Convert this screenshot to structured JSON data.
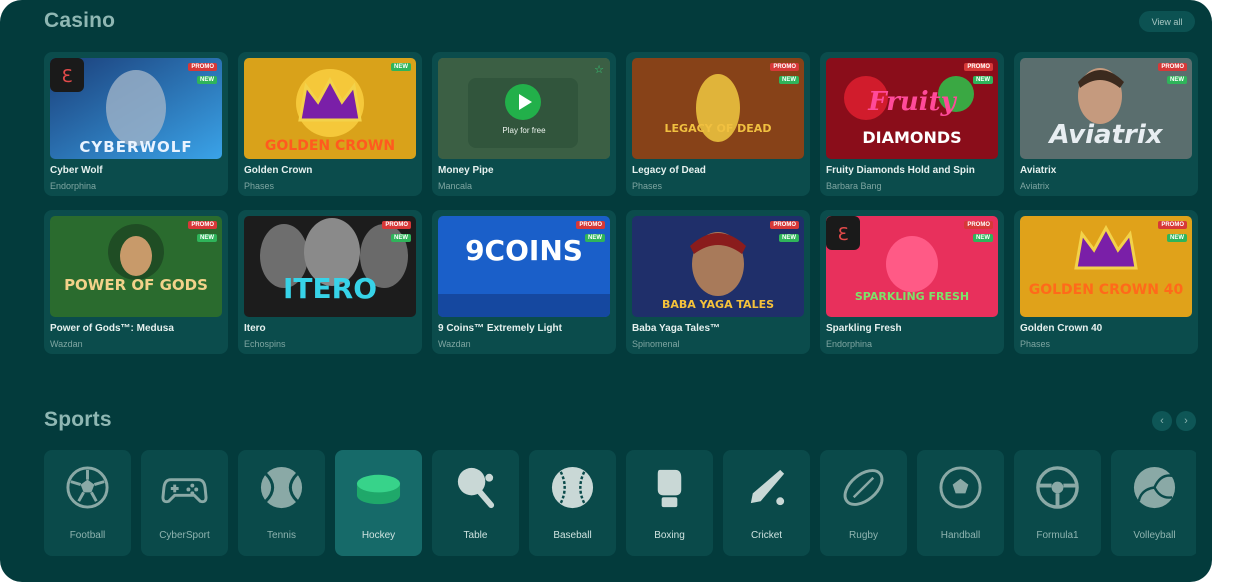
{
  "casino": {
    "title": "Casino",
    "view_all": "View all",
    "games": [
      {
        "name": "Cyber Wolf",
        "provider": "Endorphina",
        "promo": "PROMO",
        "new": "NEW",
        "art": "CYBERWOLF"
      },
      {
        "name": "Golden Crown",
        "provider": "Phases",
        "promo": "",
        "new": "NEW",
        "art": "GOLDEN CROWN"
      },
      {
        "name": "Money Pipe",
        "provider": "Mancala",
        "promo": "",
        "new": "",
        "art": "",
        "play_label": "Play for free"
      },
      {
        "name": "Legacy of Dead",
        "provider": "Phases",
        "promo": "PROMO",
        "new": "NEW",
        "art": "LEGACY OF DEAD"
      },
      {
        "name": "Fruity Diamonds Hold and Spin",
        "provider": "Barbara Bang",
        "promo": "PROMO",
        "new": "NEW",
        "art": "DIAMONDS"
      },
      {
        "name": "Aviatrix",
        "provider": "Aviatrix",
        "promo": "PROMO",
        "new": "NEW",
        "art": "Aviatrix"
      },
      {
        "name": "Power of Gods™: Medusa",
        "provider": "Wazdan",
        "promo": "PROMO",
        "new": "NEW",
        "art": "POWER OF GODS"
      },
      {
        "name": "Itero",
        "provider": "Echospins",
        "promo": "PROMO",
        "new": "NEW",
        "art": "ITERO"
      },
      {
        "name": "9 Coins™ Extremely Light",
        "provider": "Wazdan",
        "promo": "PROMO",
        "new": "NEW",
        "art": "9COINS"
      },
      {
        "name": "Baba Yaga Tales™",
        "provider": "Spinomenal",
        "promo": "PROMO",
        "new": "NEW",
        "art": "BABA YAGA TALES"
      },
      {
        "name": "Sparkling Fresh",
        "provider": "Endorphina",
        "promo": "PROMO",
        "new": "NEW",
        "art": "SPARKLING FRESH"
      },
      {
        "name": "Golden Crown 40",
        "provider": "Phases",
        "promo": "PROMO",
        "new": "NEW",
        "art": "GOLDEN CROWN 40"
      }
    ]
  },
  "sports": {
    "title": "Sports",
    "items": [
      {
        "label": "Football",
        "icon": "football-icon"
      },
      {
        "label": "CyberSport",
        "icon": "gamepad-icon"
      },
      {
        "label": "Tennis",
        "icon": "tennis-ball-icon"
      },
      {
        "label": "Hockey",
        "icon": "hockey-puck-icon",
        "active": true
      },
      {
        "label": "Table",
        "icon": "table-tennis-icon"
      },
      {
        "label": "Baseball",
        "icon": "baseball-icon"
      },
      {
        "label": "Boxing",
        "icon": "boxing-glove-icon"
      },
      {
        "label": "Cricket",
        "icon": "cricket-bat-icon"
      },
      {
        "label": "Rugby",
        "icon": "rugby-ball-icon"
      },
      {
        "label": "Handball",
        "icon": "handball-icon"
      },
      {
        "label": "Formula1",
        "icon": "steering-wheel-icon"
      },
      {
        "label": "Volleyball",
        "icon": "volleyball-icon"
      }
    ]
  },
  "colors": {
    "background": "#033b3c",
    "card": "#0b4c4c",
    "promo": "#d73838",
    "new": "#2fb45a",
    "accent": "#22b04a"
  }
}
